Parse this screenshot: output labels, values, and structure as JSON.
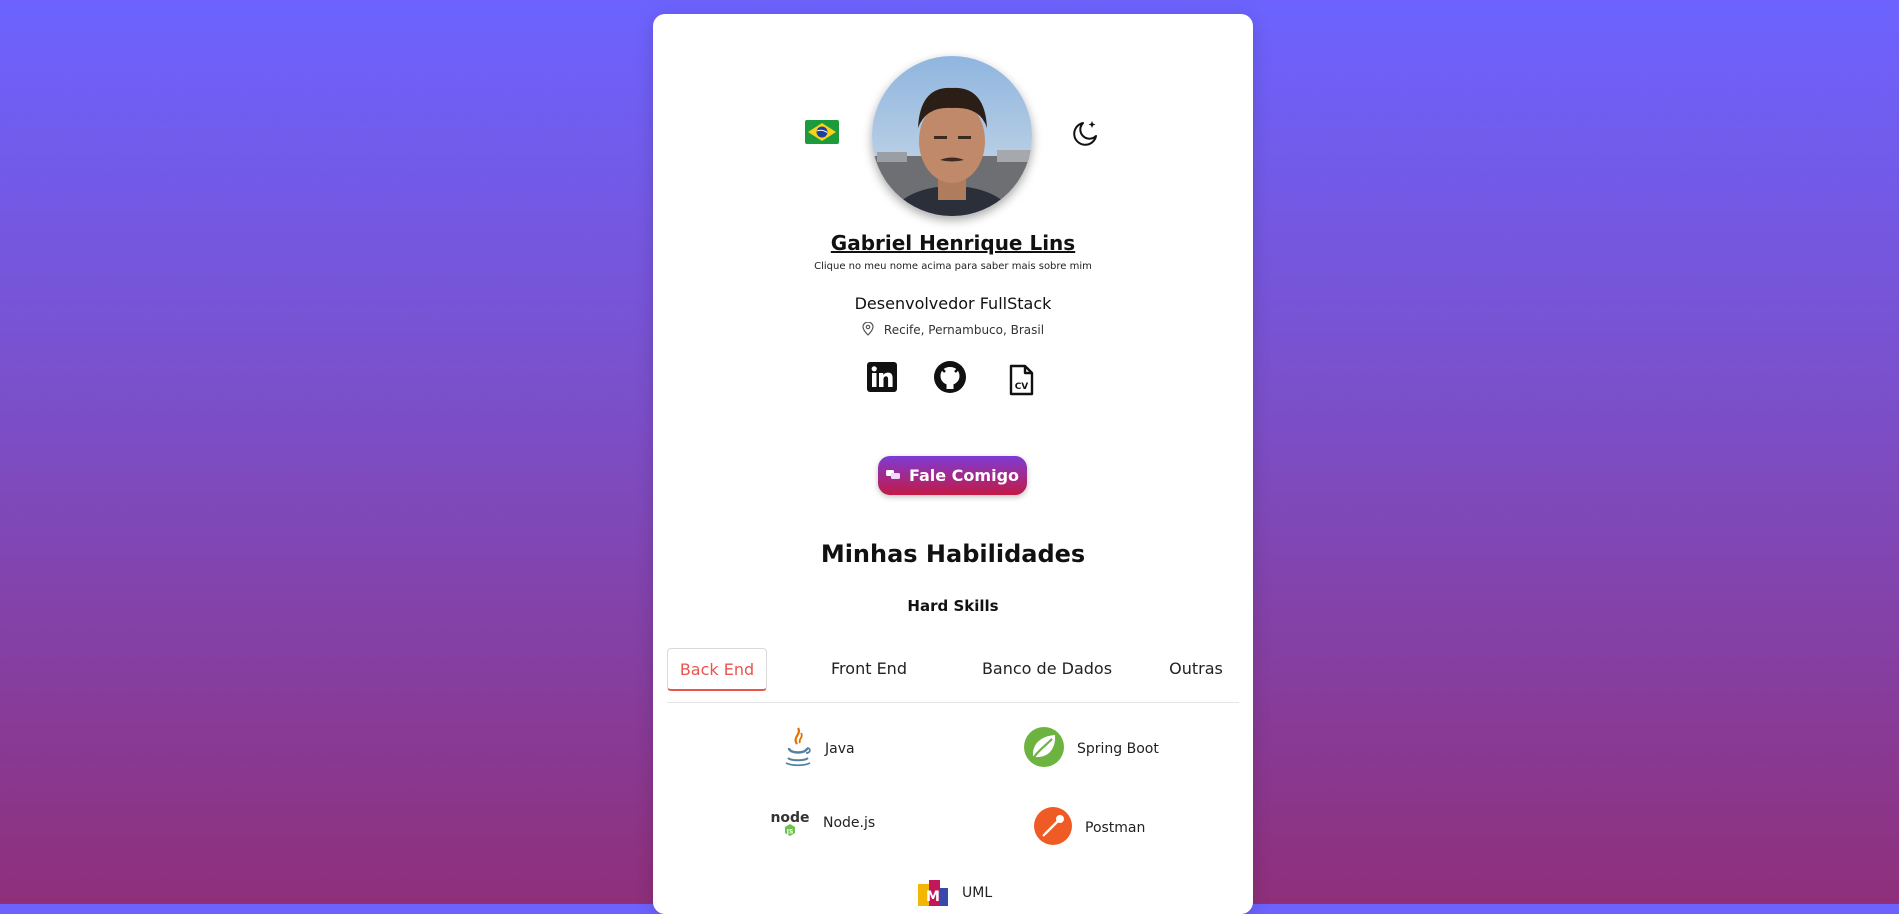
{
  "profile": {
    "name": "Gabriel Henrique Lins",
    "hint": "Clique no meu nome acima para saber mais sobre mim",
    "role": "Desenvolvedor FullStack",
    "location": "Recife, Pernambuco, Brasil"
  },
  "contact_button": {
    "label": "Fale Comigo"
  },
  "skills": {
    "title": "Minhas Habilidades",
    "subtitle": "Hard Skills",
    "tabs": [
      {
        "label": "Back End",
        "active": true
      },
      {
        "label": "Front End",
        "active": false
      },
      {
        "label": "Banco de Dados",
        "active": false
      },
      {
        "label": "Outras",
        "active": false
      }
    ],
    "items": [
      {
        "label": "Java",
        "icon": "java-icon"
      },
      {
        "label": "Spring Boot",
        "icon": "spring-boot-icon"
      },
      {
        "label": "Node.js",
        "icon": "nodejs-icon"
      },
      {
        "label": "Postman",
        "icon": "postman-icon"
      },
      {
        "label": "UML",
        "icon": "uml-icon"
      }
    ]
  },
  "icons": {
    "flag": "brazil-flag-icon",
    "theme": "moon-stars-icon",
    "socials": [
      "linkedin-icon",
      "github-icon",
      "cv-file-icon"
    ]
  },
  "colors": {
    "accent_tab": "#e8554e",
    "button_top": "#7e3bd6",
    "button_bottom": "#c21a44"
  }
}
